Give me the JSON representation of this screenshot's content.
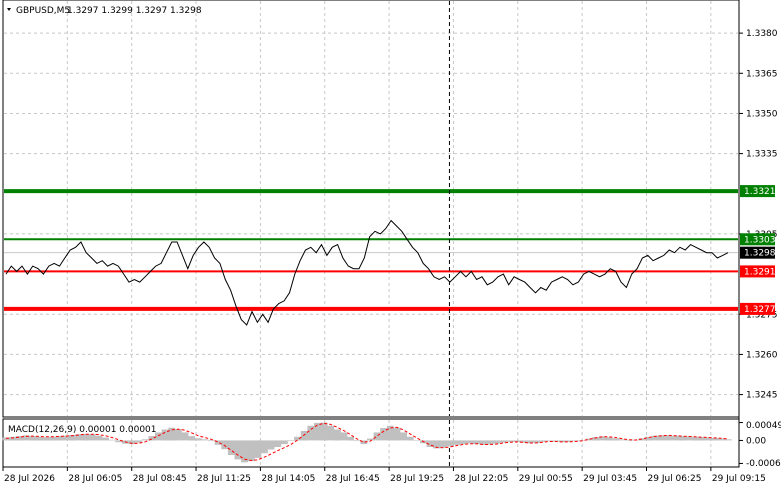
{
  "header": {
    "symbol_label": "GBPUSD,M5",
    "ohlc_label": "1.3297 1.3299 1.3297 1.3298"
  },
  "macd_header": {
    "label": "MACD(12,26,9) 0.00001 0.00001"
  },
  "colors": {
    "price_line": "#000000",
    "grid": "#c8c8c8",
    "green_line": "#008000",
    "red_line": "#ff0000",
    "current_tag": "#000000",
    "macd_hist": "#c0c0c0",
    "macd_signal": "#ff0000",
    "separator": "#000000"
  },
  "chart_data": [
    {
      "type": "line",
      "title": "",
      "ylim": [
        1.3237,
        1.3392
      ],
      "y_ticks": [
        "1.3380",
        "1.3365",
        "1.3350",
        "1.3335",
        "1.3305",
        "1.3275",
        "1.3260",
        "1.3245"
      ],
      "x_ticks": [
        "28 Jul 2026",
        "28 Jul 06:05",
        "28 Jul 08:45",
        "28 Jul 11:25",
        "28 Jul 14:05",
        "28 Jul 16:45",
        "28 Jul 19:25",
        "28 Jul 22:05",
        "29 Jul 00:55",
        "29 Jul 03:45",
        "29 Jul 06:25",
        "29 Jul 09:15"
      ],
      "horizontal_lines": [
        {
          "label": "1.3321",
          "value": 1.3321,
          "color": "green",
          "thick": true
        },
        {
          "label": "1.3303",
          "value": 1.3303,
          "color": "green",
          "thick": false
        },
        {
          "label": "1.3291",
          "value": 1.3291,
          "color": "red",
          "thick": false
        },
        {
          "label": "1.3277",
          "value": 1.3277,
          "color": "red",
          "thick": true
        }
      ],
      "current_price": {
        "label": "1.3298",
        "value": 1.3298
      },
      "vertical_marker_x_tick": "28 Jul 22:05",
      "series": [
        {
          "values": [
            1.329,
            1.3293,
            1.3291,
            1.3293,
            1.329,
            1.3293,
            1.3292,
            1.329,
            1.3293,
            1.3294,
            1.3293,
            1.3296,
            1.3299,
            1.33,
            1.3302,
            1.3298,
            1.3296,
            1.3294,
            1.3295,
            1.3293,
            1.3294,
            1.3293,
            1.329,
            1.3287,
            1.3288,
            1.3287,
            1.3289,
            1.3291,
            1.3293,
            1.3294,
            1.3298,
            1.3302,
            1.3302,
            1.3297,
            1.3292,
            1.3297,
            1.33,
            1.3302,
            1.33,
            1.3296,
            1.3294,
            1.3288,
            1.3284,
            1.3278,
            1.3273,
            1.3271,
            1.3276,
            1.3272,
            1.3275,
            1.3272,
            1.3277,
            1.3279,
            1.328,
            1.3283,
            1.329,
            1.3295,
            1.3299,
            1.33,
            1.3298,
            1.3301,
            1.3297,
            1.33,
            1.3301,
            1.3296,
            1.3293,
            1.3292,
            1.3292,
            1.3296,
            1.3304,
            1.3306,
            1.3305,
            1.3307,
            1.331,
            1.3308,
            1.3306,
            1.3303,
            1.33,
            1.3298,
            1.3294,
            1.3292,
            1.3289,
            1.3288,
            1.3289,
            1.3287,
            1.3289,
            1.3291,
            1.3289,
            1.3291,
            1.3288,
            1.3289,
            1.3286,
            1.3287,
            1.3289,
            1.329,
            1.3286,
            1.3289,
            1.3288,
            1.3287,
            1.3285,
            1.3283,
            1.3285,
            1.3284,
            1.3287,
            1.3288,
            1.3289,
            1.3288,
            1.3286,
            1.3287,
            1.329,
            1.3291,
            1.329,
            1.3289,
            1.329,
            1.3292,
            1.3291,
            1.3287,
            1.3285,
            1.329,
            1.3292,
            1.3296,
            1.3297,
            1.3295,
            1.3296,
            1.3297,
            1.3299,
            1.3298,
            1.33,
            1.3299,
            1.3301,
            1.33,
            1.3299,
            1.3298,
            1.3298,
            1.3296,
            1.3297,
            1.3298
          ]
        }
      ]
    },
    {
      "type": "bar",
      "title": "MACD(12,26,9)",
      "ylim": [
        -0.0007,
        0.00056
      ],
      "y_ticks": [
        "0.00049",
        "0.00",
        "-0.00063"
      ],
      "series": [
        {
          "values": [
            8e-05,
            0.0001,
            0.00012,
            0.00014,
            0.00012,
            0.0001,
            9e-05,
            0.0001,
            0.00012,
            0.00013,
            0.00015,
            0.00017,
            0.00018,
            0.00017,
            0.00013,
            8e-05,
            2e-05,
            -5e-05,
            -9e-05,
            -0.0001,
            -6e-05,
            3e-05,
            0.00012,
            0.00022,
            0.0003,
            0.00035,
            0.00031,
            0.00022,
            0.00012,
            6e-05,
            3e-05,
            -2e-05,
            -0.00012,
            -0.00024,
            -0.0004,
            -0.00052,
            -0.0006,
            -0.00057,
            -0.00048,
            -0.00035,
            -0.00025,
            -0.00018,
            -0.0001,
            -2e-05,
            0.0001,
            0.00026,
            0.0004,
            0.00048,
            0.00049,
            0.0004,
            0.0003,
            0.00022,
            0.0001,
            -2e-05,
            -0.0001,
            5e-05,
            0.00022,
            0.00034,
            0.0004,
            0.00035,
            0.00022,
            0.0001,
            1e-05,
            -8e-05,
            -0.00018,
            -0.00022,
            -0.0002,
            -0.00016,
            -0.00012,
            -0.0001,
            -8e-05,
            -0.0001,
            -0.00012,
            -0.00011,
            -9e-05,
            -6e-05,
            -4e-05,
            -4e-05,
            -6e-05,
            -8e-05,
            -7e-05,
            -4e-05,
            -2e-05,
            -3e-05,
            -5e-05,
            -4e-05,
            -2e-05,
            1e-05,
            5e-05,
            9e-05,
            0.00011,
            9e-05,
            6e-05,
            3e-05,
            -1e-05,
            2e-05,
            6e-05,
            0.0001,
            0.00013,
            0.00014,
            0.00014,
            0.00013,
            0.00012,
            0.00011,
            0.0001,
            9e-05,
            8e-05,
            7e-05,
            5e-05,
            3e-05
          ]
        },
        {
          "name": "signal",
          "values": [
            6e-05,
            7e-05,
            9e-05,
            0.00011,
            0.00012,
            0.00011,
            0.0001,
            0.0001,
            0.00011,
            0.00012,
            0.00013,
            0.00015,
            0.00017,
            0.00017,
            0.00016,
            0.00013,
            8e-05,
            2e-05,
            -4e-05,
            -8e-05,
            -8e-05,
            -4e-05,
            4e-05,
            0.00013,
            0.00022,
            0.00029,
            0.00031,
            0.00028,
            0.00021,
            0.00013,
            8e-05,
            3e-05,
            -4e-05,
            -0.00014,
            -0.00027,
            -0.0004,
            -0.00051,
            -0.00055,
            -0.00053,
            -0.00046,
            -0.00037,
            -0.00028,
            -0.0002,
            -0.00011,
            1e-05,
            0.00015,
            0.0003,
            0.00042,
            0.00047,
            0.00044,
            0.00036,
            0.00027,
            0.00016,
            4e-05,
            -5e-05,
            -2e-05,
            0.00012,
            0.00025,
            0.00034,
            0.00036,
            0.00029,
            0.00018,
            7e-05,
            -3e-05,
            -0.00012,
            -0.00019,
            -0.0002,
            -0.00018,
            -0.00014,
            -0.00011,
            -9e-05,
            -9e-05,
            -0.00011,
            -0.00011,
            -0.0001,
            -7e-05,
            -5e-05,
            -4e-05,
            -5e-05,
            -7e-05,
            -7e-05,
            -5e-05,
            -3e-05,
            -3e-05,
            -4e-05,
            -4e-05,
            -3e-05,
            -1e-05,
            3e-05,
            7e-05,
            0.0001,
            0.0001,
            8e-05,
            5e-05,
            2e-05,
            1e-05,
            4e-05,
            8e-05,
            0.00011,
            0.00013,
            0.00014,
            0.00013,
            0.00012,
            0.00011,
            0.0001,
            9e-05,
            8e-05,
            7e-05,
            6e-05,
            4e-05
          ]
        }
      ]
    }
  ]
}
